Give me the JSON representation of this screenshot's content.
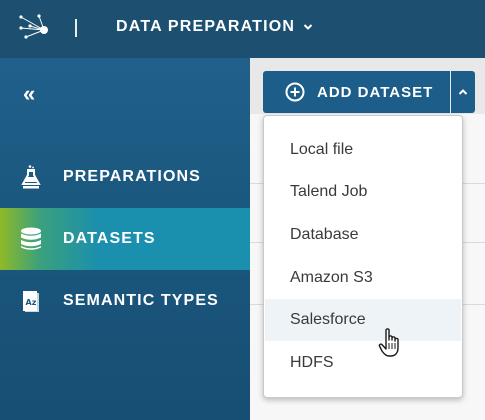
{
  "header": {
    "app_title": "DATA PREPARATION",
    "logo_icon": "talend-network-logo",
    "title_menu_icon": "chevron-down-icon"
  },
  "sidebar": {
    "collapse_label": "«",
    "items": [
      {
        "label": "PREPARATIONS",
        "icon": "flask-icon",
        "active": false
      },
      {
        "label": "DATASETS",
        "icon": "database-icon",
        "active": true
      },
      {
        "label": "SEMANTIC TYPES",
        "icon": "semantic-book-icon",
        "active": false
      }
    ]
  },
  "toolbar": {
    "add_dataset_label": "ADD DATASET",
    "add_icon": "plus-circle-icon",
    "toggle_icon": "chevron-up-icon"
  },
  "dropdown": {
    "items": [
      "Local file",
      "Talend Job",
      "Database",
      "Amazon S3",
      "Salesforce",
      "HDFS"
    ],
    "hovered": "Salesforce"
  },
  "colors": {
    "header_bg": "#1d4f71",
    "sidebar_bg": "#1b587f",
    "active_item": "#1a8fae",
    "active_accent": "#8fba27",
    "button_bg": "#1d5d8a"
  }
}
